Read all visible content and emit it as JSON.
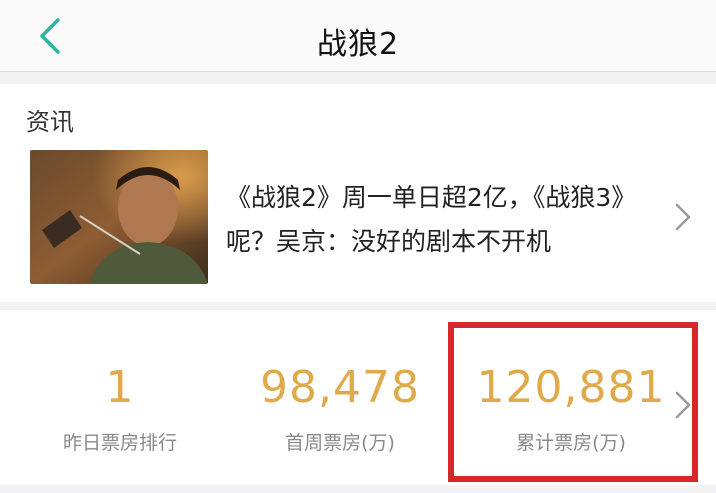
{
  "nav": {
    "title": "战狼2",
    "back_icon": "chevron-left-icon",
    "accent_color": "#2bb3a3"
  },
  "news": {
    "section_label": "资讯",
    "item": {
      "headline": "《战狼2》周一单日超2亿，《战狼3》呢？吴京：没好的剧本不开机",
      "thumbnail_icon": "movie-still-image",
      "chevron_icon": "chevron-right-icon"
    }
  },
  "stats": {
    "value_color": "#e0a94a",
    "highlight_color": "#d6282b",
    "items": [
      {
        "value": "1",
        "label": "昨日票房排行"
      },
      {
        "value": "98,478",
        "label": "首周票房(万)"
      },
      {
        "value": "120,881",
        "label": "累计票房(万)"
      }
    ],
    "chevron_icon": "chevron-right-icon"
  }
}
